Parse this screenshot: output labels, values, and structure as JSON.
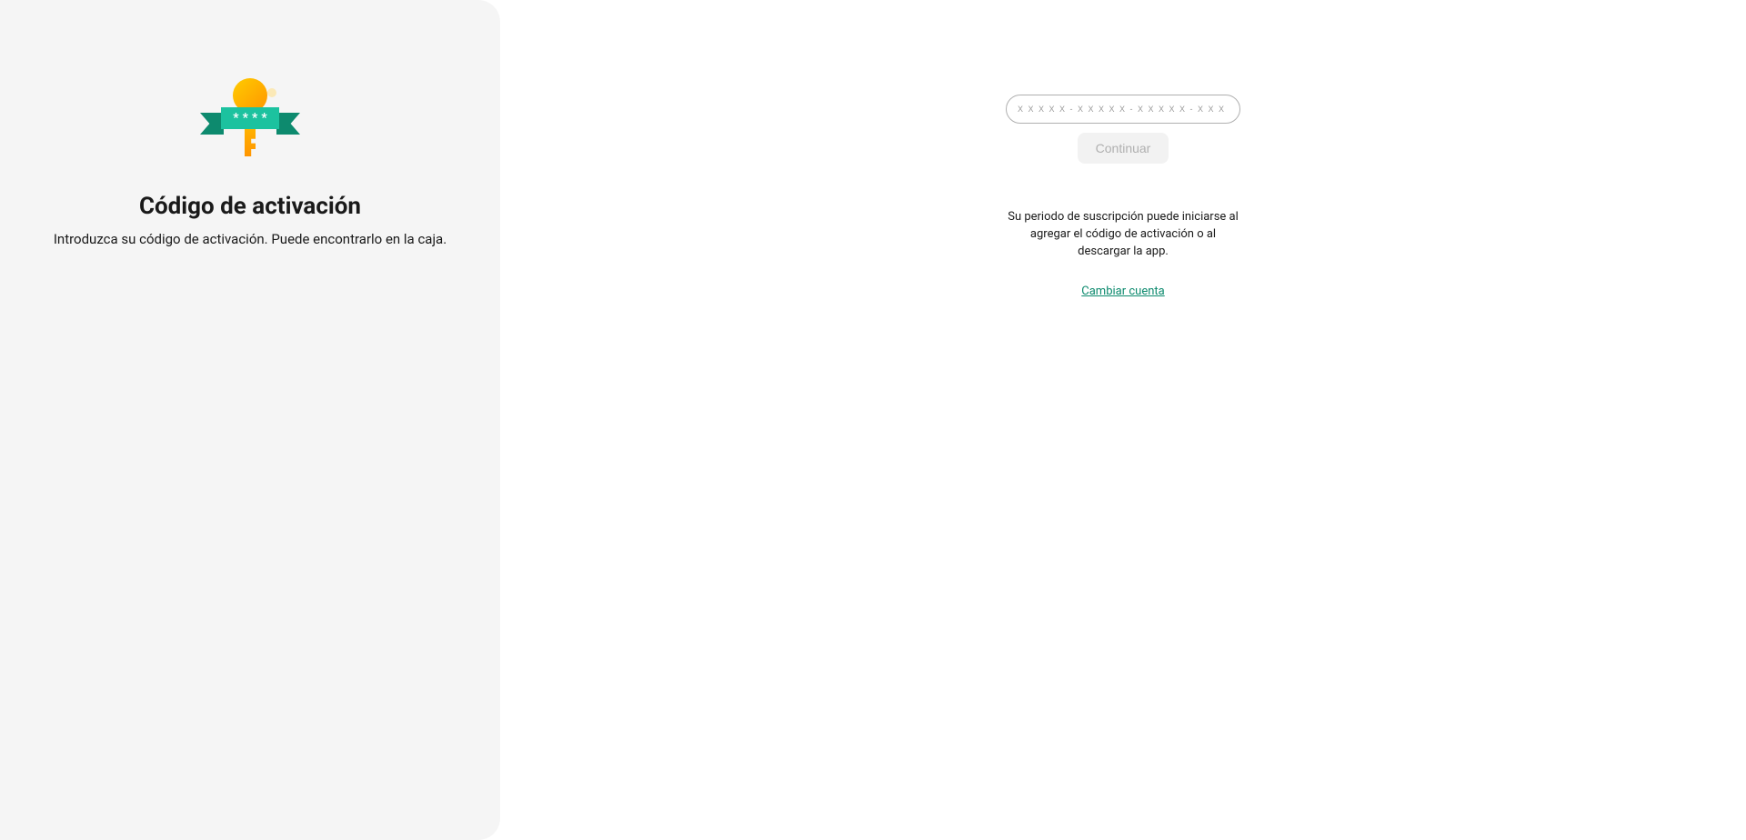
{
  "left": {
    "title": "Código de activación",
    "subtitle": "Introduzca su código de activación. Puede encontrarlo en la caja."
  },
  "form": {
    "placeholder": "X X X X X - X X X X X - X X X X X - X X X X X",
    "value": "",
    "continue_label": "Continuar"
  },
  "info": {
    "text": "Su periodo de suscripción puede iniciarse al agregar el código de activación o al descargar la app.",
    "change_account_label": "Cambiar cuenta"
  },
  "icons": {
    "key": "activation-key-icon"
  }
}
